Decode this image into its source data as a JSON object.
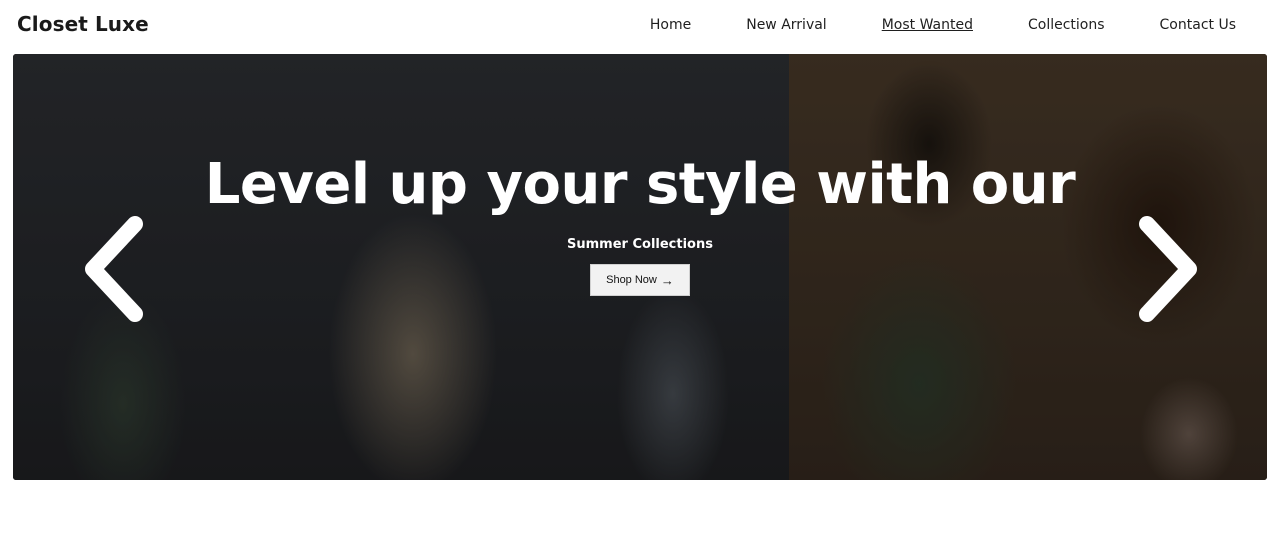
{
  "header": {
    "brand": "Closet Luxe",
    "nav": [
      {
        "label": "Home",
        "active": false
      },
      {
        "label": "New Arrival",
        "active": false
      },
      {
        "label": "Most Wanted",
        "active": true
      },
      {
        "label": "Collections",
        "active": false
      },
      {
        "label": "Contact Us",
        "active": false
      }
    ]
  },
  "hero": {
    "title": "Level up your style with our",
    "subtitle": "Summer Collections",
    "cta_label": "Shop Now",
    "cta_icon": "arrow-right-icon",
    "prev_icon": "chevron-left-icon",
    "next_icon": "chevron-right-icon"
  },
  "colors": {
    "text_dark": "#1a1a1a",
    "hero_text": "#ffffff",
    "button_bg": "#f2f2f2"
  }
}
